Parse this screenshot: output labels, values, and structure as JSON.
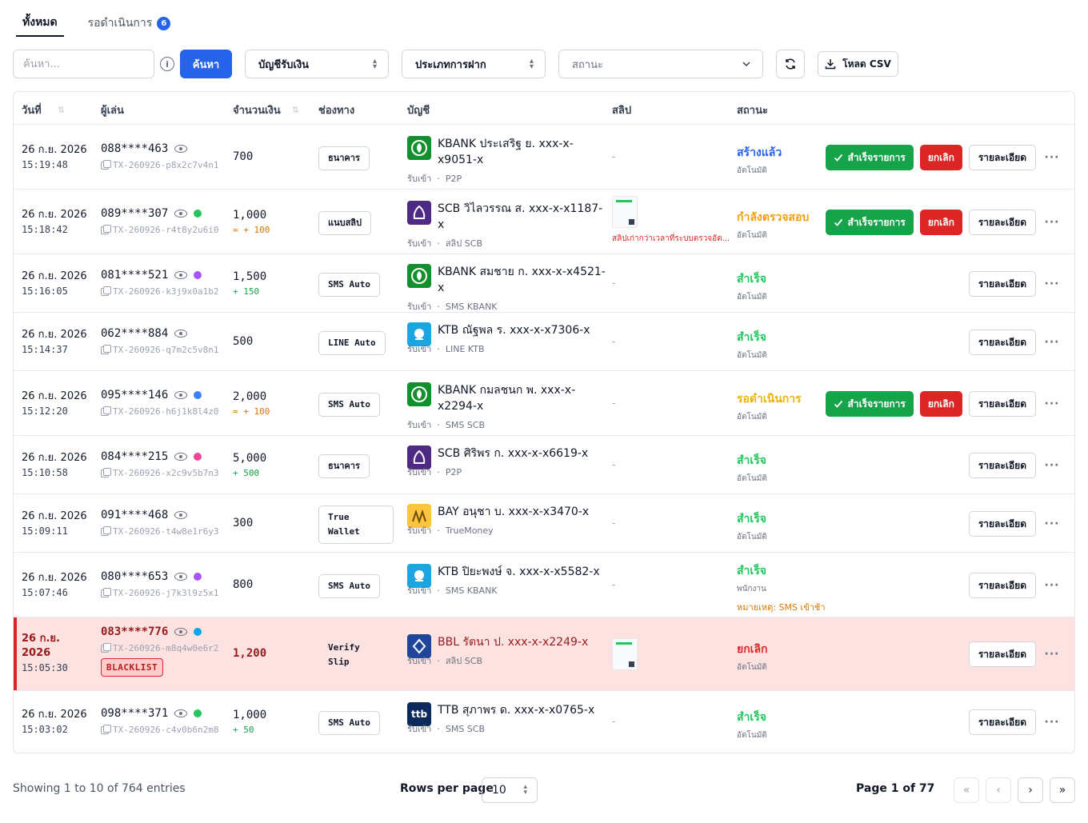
{
  "tabs": [
    {
      "label": "ทั้งหมด",
      "active": true
    },
    {
      "label": "รอดำเนินการ",
      "count": "6"
    }
  ],
  "toolbar": {
    "search_placeholder": "ค้นหา...",
    "search_button": "ค้นหา",
    "account_select": "บัญชีรับเงิน",
    "type_select": "ประเภทการฝาก",
    "status_placeholder": "สถานะ",
    "csv_button": "โหลด CSV"
  },
  "columns": {
    "date": "วันที่",
    "player": "ผู้เล่น",
    "amount": "จำนวนเงิน",
    "channel": "ช่องทาง",
    "account": "บัญชี",
    "slip": "สลิป",
    "status": "สถานะ"
  },
  "labels": {
    "approve": "สำเร็จรายการ",
    "cancel": "ยกเลิก",
    "detail": "รายละเอียด",
    "recv": "รับเข้า"
  },
  "colors": {
    "primary": "#2563eb",
    "success": "#16a34a",
    "danger": "#dc2626",
    "warning": "#d97706",
    "status_created": "#2563eb",
    "status_checking": "#f59e0b",
    "status_success": "#22c55e",
    "status_pending": "#eab308",
    "status_cancel": "#dc2626"
  },
  "rows": [
    {
      "date": "26 ก.ย. 2026",
      "time": "15:19:48",
      "phone": "088****463",
      "txid": "TX-260926-p8x2c7v4n1",
      "amount": "700",
      "bonus": "",
      "channel": "ธนาคาร",
      "bank": "KBANK",
      "bank_color": "#138f2d",
      "account": "KBANK ประเสริฐ ย. xxx-x-x9051-x",
      "source": "P2P",
      "slip": "-",
      "slip_note": "",
      "status": "สร้างแล้ว",
      "status_color": "#2563eb",
      "status_sub": "อัตโนมัติ",
      "status_note": "",
      "actions": true
    },
    {
      "date": "26 ก.ย. 2026",
      "time": "15:18:42",
      "phone": "089****307",
      "dot": "#22c55e",
      "txid": "TX-260926-r4t8y2u6i0",
      "amount": "1,000",
      "bonus": "≈ + 100",
      "bonus_warn": true,
      "channel": "แนบสลิป",
      "bank": "SCB",
      "bank_color": "#4e2a84",
      "account": "SCB วิไลวรรณ ส. xxx-x-x1187-x",
      "source": "สลิป SCB",
      "slip_img": true,
      "slip_note": "สลิปเก่ากว่าเวลาที่ระบบตรวจอัต...",
      "status": "กำลังตรวจสอบ",
      "status_color": "#f59e0b",
      "status_sub": "อัตโนมัติ",
      "status_note": "",
      "actions": true
    },
    {
      "date": "26 ก.ย. 2026",
      "time": "15:16:05",
      "phone": "081****521",
      "dot": "#a855f7",
      "txid": "TX-260926-k3j9x0a1b2",
      "amount": "1,500",
      "bonus": "+ 150",
      "channel": "SMS Auto",
      "bank": "KBANK",
      "bank_color": "#138f2d",
      "account": "KBANK สมชาย ก. xxx-x-x4521-x",
      "source": "SMS KBANK",
      "slip": "-",
      "slip_note": "",
      "status": "สำเร็จ",
      "status_color": "#22c55e",
      "status_sub": "อัตโนมัติ",
      "status_note": "",
      "actions": false
    },
    {
      "date": "26 ก.ย. 2026",
      "time": "15:14:37",
      "phone": "062****884",
      "txid": "TX-260926-q7m2c5v8n1",
      "amount": "500",
      "bonus": "",
      "channel": "LINE Auto",
      "bank": "KTB",
      "bank_color": "#1ba5e1",
      "account": "KTB ณัฐพล ร. xxx-x-x7306-x",
      "source": "LINE KTB",
      "slip": "-",
      "slip_note": "",
      "status": "สำเร็จ",
      "status_color": "#22c55e",
      "status_sub": "อัตโนมัติ",
      "status_note": "",
      "actions": false
    },
    {
      "date": "26 ก.ย. 2026",
      "time": "15:12:20",
      "phone": "095****146",
      "dot": "#3b82f6",
      "txid": "TX-260926-h6j1k8l4z0",
      "amount": "2,000",
      "bonus": "≈ + 100",
      "bonus_warn": true,
      "channel": "SMS Auto",
      "bank": "KBANK",
      "bank_color": "#138f2d",
      "account": "KBANK กมลชนก พ. xxx-x-x2294-x",
      "source": "SMS SCB",
      "slip": "-",
      "slip_note": "",
      "status": "รอดำเนินการ",
      "status_color": "#eab308",
      "status_sub": "อัตโนมัติ",
      "status_note": "",
      "actions": true
    },
    {
      "date": "26 ก.ย. 2026",
      "time": "15:10:58",
      "phone": "084****215",
      "dot": "#ec4899",
      "txid": "TX-260926-x2c9v5b7n3",
      "amount": "5,000",
      "bonus": "+ 500",
      "channel": "ธนาคาร",
      "bank": "SCB",
      "bank_color": "#4e2a84",
      "account": "SCB ศิริพร ก. xxx-x-x6619-x",
      "source": "P2P",
      "slip": "-",
      "slip_note": "",
      "status": "สำเร็จ",
      "status_color": "#22c55e",
      "status_sub": "อัตโนมัติ",
      "status_note": "",
      "actions": false
    },
    {
      "date": "26 ก.ย. 2026",
      "time": "15:09:11",
      "phone": "091****468",
      "txid": "TX-260926-t4w8e1r6y3",
      "amount": "300",
      "bonus": "",
      "channel": "True Wallet",
      "bank": "BAY",
      "bank_color": "#fec43b",
      "account": "BAY อนุชา บ. xxx-x-x3470-x",
      "source": "TrueMoney",
      "slip": "-",
      "slip_note": "",
      "status": "สำเร็จ",
      "status_color": "#22c55e",
      "status_sub": "อัตโนมัติ",
      "status_note": "",
      "actions": false
    },
    {
      "date": "26 ก.ย. 2026",
      "time": "15:07:46",
      "phone": "080****653",
      "dot": "#a855f7",
      "txid": "TX-260926-j7k3l9z5x1",
      "amount": "800",
      "bonus": "",
      "channel": "SMS Auto",
      "bank": "KTB",
      "bank_color": "#1ba5e1",
      "account": "KTB ปิยะพงษ์ จ. xxx-x-x5582-x",
      "source": "SMS KBANK",
      "slip": "-",
      "slip_note": "",
      "status": "สำเร็จ",
      "status_color": "#22c55e",
      "status_sub": "พนักงาน",
      "status_note": "หมายเหตุ: SMS เข้าช้า",
      "actions": false
    },
    {
      "date": "26 ก.ย. 2026",
      "time": "15:05:30",
      "phone": "083****776",
      "dot": "#0ea5e9",
      "txid": "TX-260926-m8q4w0e6r2",
      "amount": "1,200",
      "bonus": "",
      "channel": "Verify Slip",
      "bank": "BBL",
      "bank_color": "#1e4598",
      "account": "BBL รัตนา ป. xxx-x-x2249-x",
      "source": "สลิป SCB",
      "slip_img": true,
      "slip_note": "",
      "status": "ยกเลิก",
      "status_color": "#dc2626",
      "status_sub": "อัตโนมัติ",
      "status_note": "",
      "actions": false,
      "blacklist": "BLACKLIST"
    },
    {
      "date": "26 ก.ย. 2026",
      "time": "15:03:02",
      "phone": "098****371",
      "dot": "#22c55e",
      "txid": "TX-260926-c4v0b6n2m8",
      "amount": "1,000",
      "bonus": "+ 50",
      "channel": "SMS Auto",
      "bank": "TTB",
      "bank_color": "#0b2a5b",
      "account": "TTB สุภาพร ด. xxx-x-x0765-x",
      "source": "SMS SCB",
      "slip": "-",
      "slip_note": "",
      "status": "สำเร็จ",
      "status_color": "#22c55e",
      "status_sub": "อัตโนมัติ",
      "status_note": "",
      "actions": false
    }
  ],
  "footer": {
    "showing": "Showing 1 to 10 of 764 entries",
    "rows_per_page_label": "Rows per page",
    "rows_per_page": "10",
    "page_info": "Page 1 of 77"
  }
}
